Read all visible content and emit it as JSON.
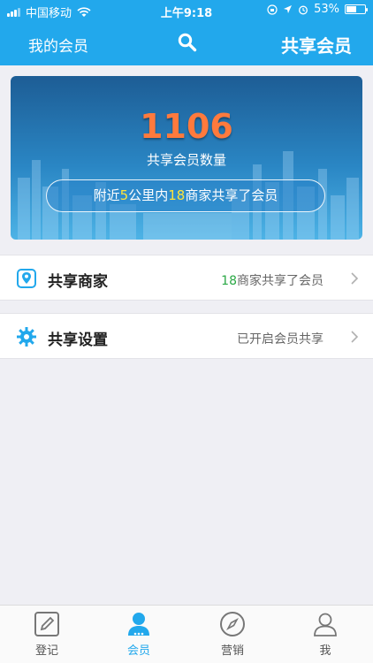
{
  "status_bar": {
    "carrier": "中国移动",
    "time": "上午9:18",
    "battery": "53%",
    "battery_level": 0.53
  },
  "header": {
    "left_label": "我的会员",
    "title": "共享会员",
    "search_icon": "search-icon"
  },
  "banner": {
    "count": "1106",
    "count_label": "共享会员数量",
    "pill_prefix": "附近",
    "pill_km": "5",
    "pill_mid": "公里内",
    "pill_merchants": "18",
    "pill_suffix": "商家共享了会员"
  },
  "rows": {
    "shared_merchants": {
      "title": "共享商家",
      "count": "18",
      "value_suffix": "商家共享了会员",
      "icon": "location-pin-icon"
    },
    "shared_settings": {
      "title": "共享设置",
      "value": "已开启会员共享",
      "icon": "gear-icon"
    }
  },
  "tabbar": {
    "items": [
      {
        "label": "登记",
        "icon": "pencil-icon"
      },
      {
        "label": "会员",
        "icon": "member-icon"
      },
      {
        "label": "营销",
        "icon": "compass-icon"
      },
      {
        "label": "我",
        "icon": "profile-icon"
      }
    ],
    "active_index": 1
  },
  "colors": {
    "accent": "#22a8ec",
    "count": "#ff7a3d",
    "highlight": "#ffe43a",
    "green": "#2aa845"
  }
}
